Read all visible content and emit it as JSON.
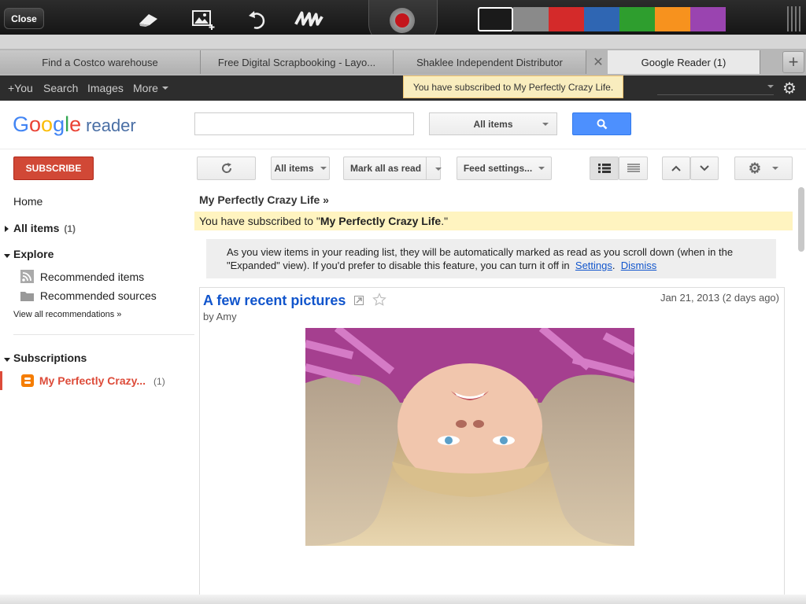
{
  "annotation_toolbar": {
    "close_label": "Close",
    "tools": [
      "eraser-icon",
      "add-image-icon",
      "undo-icon",
      "scribble-icon"
    ],
    "swatches": [
      "#1a1a1a",
      "#8a8a8a",
      "#d42a2a",
      "#2f66b3",
      "#2e9e2e",
      "#f7921e",
      "#9a44b0"
    ]
  },
  "browser": {
    "tabs": [
      {
        "label": "Find a Costco warehouse"
      },
      {
        "label": "Free Digital Scrapbooking - Layo..."
      },
      {
        "label": "Shaklee Independent Distributor"
      },
      {
        "label": "Google Reader (1)"
      }
    ],
    "new_tab_label": "+"
  },
  "gbar": {
    "links": [
      "+You",
      "Search",
      "Images",
      "More"
    ],
    "toast": "You have subscribed to My Perfectly Crazy Life."
  },
  "header": {
    "logo_letters": [
      "G",
      "o",
      "o",
      "g",
      "l",
      "e"
    ],
    "logo_suffix": "reader",
    "search_value": "",
    "scope_label": "All items"
  },
  "toolbar": {
    "subscribe_label": "SUBSCRIBE",
    "all_items_label": "All items",
    "mark_read_label": "Mark all as read",
    "feed_settings_label": "Feed settings..."
  },
  "sidebar": {
    "home": "Home",
    "all_items": "All items",
    "all_items_count": "(1)",
    "explore": "Explore",
    "recommended_items": "Recommended items",
    "recommended_sources": "Recommended sources",
    "view_all": "View all recommendations »",
    "subscriptions": "Subscriptions",
    "subscription": {
      "name": "My Perfectly Crazy...",
      "count": "(1)"
    }
  },
  "main": {
    "stream_title": "My Perfectly Crazy Life »",
    "banner_prefix": "You have subscribed to \"",
    "banner_feed": "My Perfectly Crazy Life",
    "banner_suffix": ".\"",
    "info_text": "As you view items in your reading list, they will be automatically marked as read as you scroll down (when in the \"Expanded\" view). If you'd prefer to disable this feature, you can turn it off in",
    "settings_link": "Settings",
    "dismiss_link": "Dismiss",
    "entry": {
      "title": "A few recent pictures",
      "date": "Jan 21, 2013 (2 days ago)",
      "author": "by Amy"
    }
  },
  "colors": {
    "accent": "#d14836",
    "link": "#1155cc",
    "search_blue": "#4d90fe"
  }
}
